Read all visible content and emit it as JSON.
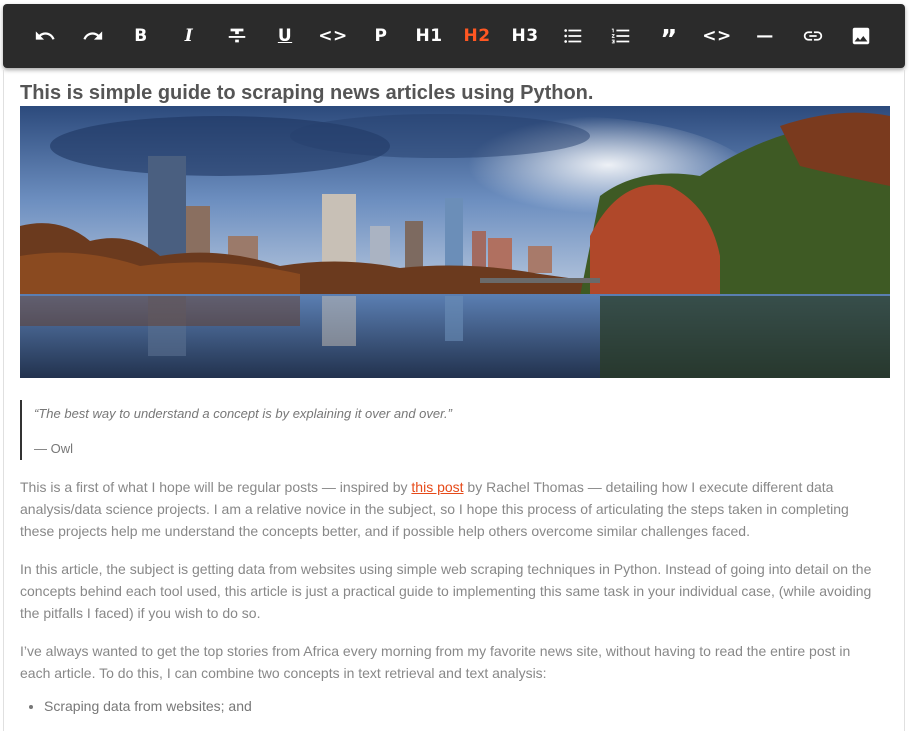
{
  "toolbar": {
    "items": [
      {
        "name": "undo-button",
        "icon": "undo-icon"
      },
      {
        "name": "redo-button",
        "icon": "redo-icon"
      },
      {
        "name": "bold-button",
        "label": "B"
      },
      {
        "name": "italic-button",
        "label": "I"
      },
      {
        "name": "strikethrough-button",
        "icon": "strikethrough-icon"
      },
      {
        "name": "underline-button",
        "label": "U"
      },
      {
        "name": "inline-code-button",
        "label": "<>"
      },
      {
        "name": "paragraph-button",
        "label": "P"
      },
      {
        "name": "heading1-button",
        "label": "H1"
      },
      {
        "name": "heading2-button",
        "label": "H2",
        "active": true
      },
      {
        "name": "heading3-button",
        "label": "H3"
      },
      {
        "name": "bullet-list-button",
        "icon": "bullet-list-icon"
      },
      {
        "name": "ordered-list-button",
        "icon": "ordered-list-icon"
      },
      {
        "name": "blockquote-button",
        "label": "”"
      },
      {
        "name": "code-block-button",
        "label": "<>"
      },
      {
        "name": "horizontal-rule-button",
        "label": "—"
      },
      {
        "name": "link-button",
        "icon": "link-icon"
      },
      {
        "name": "image-button",
        "icon": "image-icon"
      }
    ],
    "active_color": "#ff5722"
  },
  "article": {
    "title": "This is simple guide to scraping news articles using Python.",
    "quote_text": "“The best way to understand a concept is by explaining it over and over.”",
    "quote_author": "— Owl",
    "p1_before": "This is a first of what I hope will be regular posts — inspired by ",
    "p1_link": "this post",
    "p1_after": " by Rachel Thomas — detailing how I execute different data analysis/data science projects. I am a relative novice in the subject, so I hope this process of articulating the steps taken in completing these projects help me understand the concepts better, and if possible help others overcome similar challenges faced.",
    "p2": "In this article, the subject is getting data from websites using simple web scraping techniques in Python. Instead of going into detail on the concepts behind each tool used, this article is just a practical guide to implementing this same task in your individual case, (while avoiding the pitfalls I faced) if you wish to do so.",
    "p3": "I’ve always wanted to get the top stories from Africa every morning from my favorite news site, without having to read the entire post in each article. To do this, I can combine two concepts in text retrieval and text analysis:",
    "bullets": [
      "Scraping data from websites; and"
    ]
  }
}
